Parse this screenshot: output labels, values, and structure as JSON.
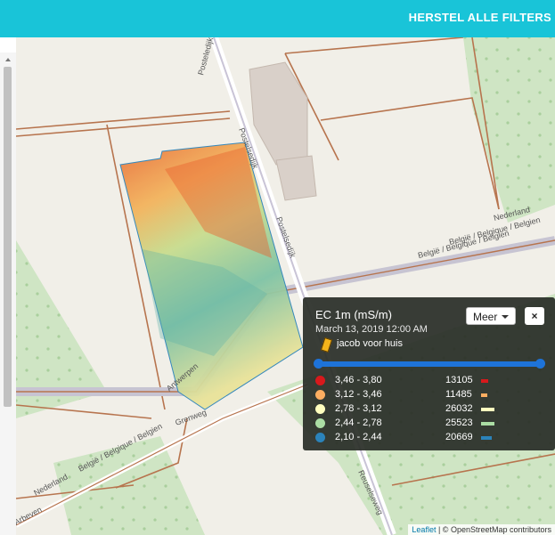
{
  "header": {
    "reset_label": "HERSTEL ALLE FILTERS",
    "bg_color": "#19c4d8"
  },
  "map": {
    "street_labels": [
      "Posteledijk",
      "Postelsedijk",
      "Postelsedijk",
      "België / Belgique / Belgien",
      "Nederland",
      "België / Belgique / Belgien",
      "Antwerpen",
      "Grenweg",
      "Reuselseweg",
      "Nederland",
      "Nederland",
      "Nederland",
      "België / Belgique / Belgien",
      "Arbeven"
    ],
    "attribution_link": "Leaflet",
    "attribution_text": "| © OpenStreetMap contributors"
  },
  "panel": {
    "title": "EC 1m (mS/m)",
    "date": "March 13, 2019 12:00 AM",
    "meer_label": "Meer",
    "close_label": "×",
    "layer_name": "jacob voor huis",
    "legend": [
      {
        "range": "3,46 - 3,80",
        "count": "13105",
        "color": "#d7191c",
        "share": 0.5
      },
      {
        "range": "3,12 - 3,46",
        "count": "11485",
        "color": "#fdae61",
        "share": 0.44
      },
      {
        "range": "2,78 - 3,12",
        "count": "26032",
        "color": "#ffffbf",
        "share": 1.0
      },
      {
        "range": "2,44 - 2,78",
        "count": "25523",
        "color": "#abdda4",
        "share": 0.98
      },
      {
        "range": "2,10 - 2,44",
        "count": "20669",
        "color": "#2b83ba",
        "share": 0.79
      }
    ]
  }
}
